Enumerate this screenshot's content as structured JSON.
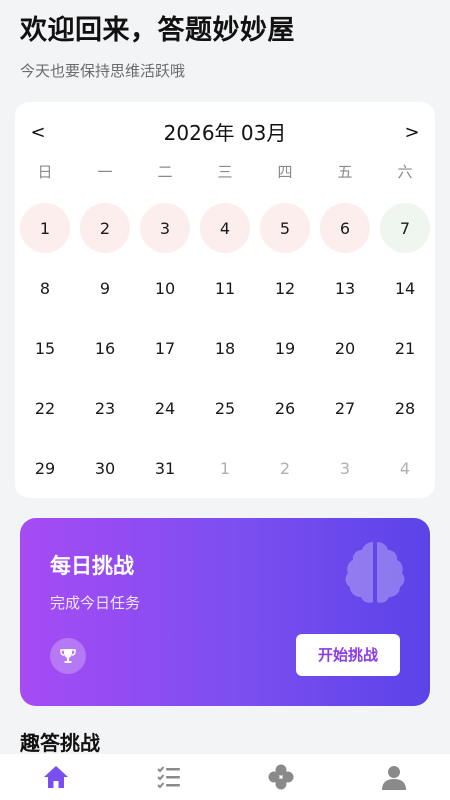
{
  "header": {
    "title": "欢迎回来，答题妙妙屋",
    "subtitle": "今天也要保持思维活跃哦"
  },
  "calendar": {
    "prev_label": "<",
    "next_label": ">",
    "month_label": "2026年 03月",
    "weekdays": [
      "日",
      "一",
      "二",
      "三",
      "四",
      "五",
      "六"
    ],
    "days": [
      {
        "label": "1",
        "state": "red"
      },
      {
        "label": "2",
        "state": "red"
      },
      {
        "label": "3",
        "state": "red"
      },
      {
        "label": "4",
        "state": "red"
      },
      {
        "label": "5",
        "state": "red"
      },
      {
        "label": "6",
        "state": "red"
      },
      {
        "label": "7",
        "state": "green"
      },
      {
        "label": "8",
        "state": "normal"
      },
      {
        "label": "9",
        "state": "normal"
      },
      {
        "label": "10",
        "state": "normal"
      },
      {
        "label": "11",
        "state": "normal"
      },
      {
        "label": "12",
        "state": "normal"
      },
      {
        "label": "13",
        "state": "normal"
      },
      {
        "label": "14",
        "state": "normal"
      },
      {
        "label": "15",
        "state": "normal"
      },
      {
        "label": "16",
        "state": "normal"
      },
      {
        "label": "17",
        "state": "normal"
      },
      {
        "label": "18",
        "state": "normal"
      },
      {
        "label": "19",
        "state": "normal"
      },
      {
        "label": "20",
        "state": "normal"
      },
      {
        "label": "21",
        "state": "normal"
      },
      {
        "label": "22",
        "state": "normal"
      },
      {
        "label": "23",
        "state": "normal"
      },
      {
        "label": "24",
        "state": "normal"
      },
      {
        "label": "25",
        "state": "normal"
      },
      {
        "label": "26",
        "state": "normal"
      },
      {
        "label": "27",
        "state": "normal"
      },
      {
        "label": "28",
        "state": "normal"
      },
      {
        "label": "29",
        "state": "normal"
      },
      {
        "label": "30",
        "state": "normal"
      },
      {
        "label": "31",
        "state": "normal"
      },
      {
        "label": "1",
        "state": "muted"
      },
      {
        "label": "2",
        "state": "muted"
      },
      {
        "label": "3",
        "state": "muted"
      },
      {
        "label": "4",
        "state": "muted"
      }
    ]
  },
  "challenge": {
    "title": "每日挑战",
    "subtitle": "完成今日任务",
    "button_label": "开始挑战",
    "decor_icon": "brain-icon",
    "badge_icon": "trophy-icon"
  },
  "section": {
    "title": "趣答挑战"
  },
  "bottom_nav": {
    "items": [
      {
        "icon": "home-icon",
        "active": true
      },
      {
        "icon": "checklist-icon",
        "active": false
      },
      {
        "icon": "clover-icon",
        "active": false
      },
      {
        "icon": "user-icon",
        "active": false
      }
    ]
  },
  "colors": {
    "accent": "#8a3ce6",
    "gradient_start": "#a64bf4",
    "gradient_end": "#5b43e8",
    "completed_day_bg": "#fdeeee",
    "today_bg": "#eef6ef",
    "nav_active": "#7b4ef0",
    "nav_inactive": "#8a8a8a"
  }
}
